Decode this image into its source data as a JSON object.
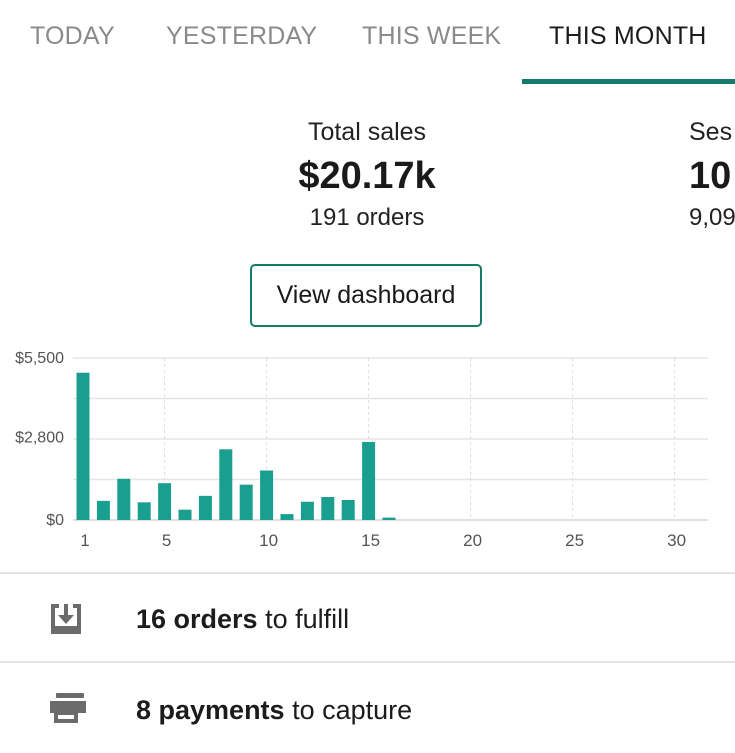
{
  "tabs": [
    {
      "label": "TODAY",
      "active": false
    },
    {
      "label": "YESTERDAY",
      "active": false
    },
    {
      "label": "THIS WEEK",
      "active": false
    },
    {
      "label": "THIS MONTH",
      "active": true
    }
  ],
  "stats": {
    "total_sales": {
      "label": "Total sales",
      "value": "$20.17k",
      "sub": "191 orders"
    },
    "sessions": {
      "label": "Ses",
      "value": "10",
      "sub": "9,09"
    }
  },
  "dashboard_button": {
    "label": "View dashboard"
  },
  "chart_data": {
    "type": "bar",
    "x_ticks": [
      "1",
      "5",
      "10",
      "15",
      "20",
      "25",
      "30"
    ],
    "y_ticks": [
      "$5,500",
      "$2,800",
      "$0"
    ],
    "ylim": [
      0,
      5500
    ],
    "days": [
      1,
      2,
      3,
      4,
      5,
      6,
      7,
      8,
      9,
      10,
      11,
      12,
      13,
      14,
      15,
      16,
      17,
      18,
      19,
      20,
      21,
      22,
      23,
      24,
      25,
      26,
      27,
      28,
      29,
      30
    ],
    "values": [
      5000,
      650,
      1400,
      600,
      1250,
      350,
      820,
      2400,
      1200,
      1680,
      200,
      620,
      780,
      680,
      2650,
      80,
      0,
      0,
      0,
      0,
      0,
      0,
      0,
      0,
      0,
      0,
      0,
      0,
      0,
      0
    ],
    "bar_color": "#1a9e8f",
    "grid": true
  },
  "tasks": [
    {
      "icon": "inbox-download-icon",
      "bold": "16 orders",
      "rest": " to fulfill"
    },
    {
      "icon": "credit-card-icon",
      "bold": "8 payments",
      "rest": " to capture"
    }
  ],
  "colors": {
    "accent": "#147a6a",
    "bar": "#1a9e8f",
    "inactive_tab": "#8a8a8a"
  }
}
